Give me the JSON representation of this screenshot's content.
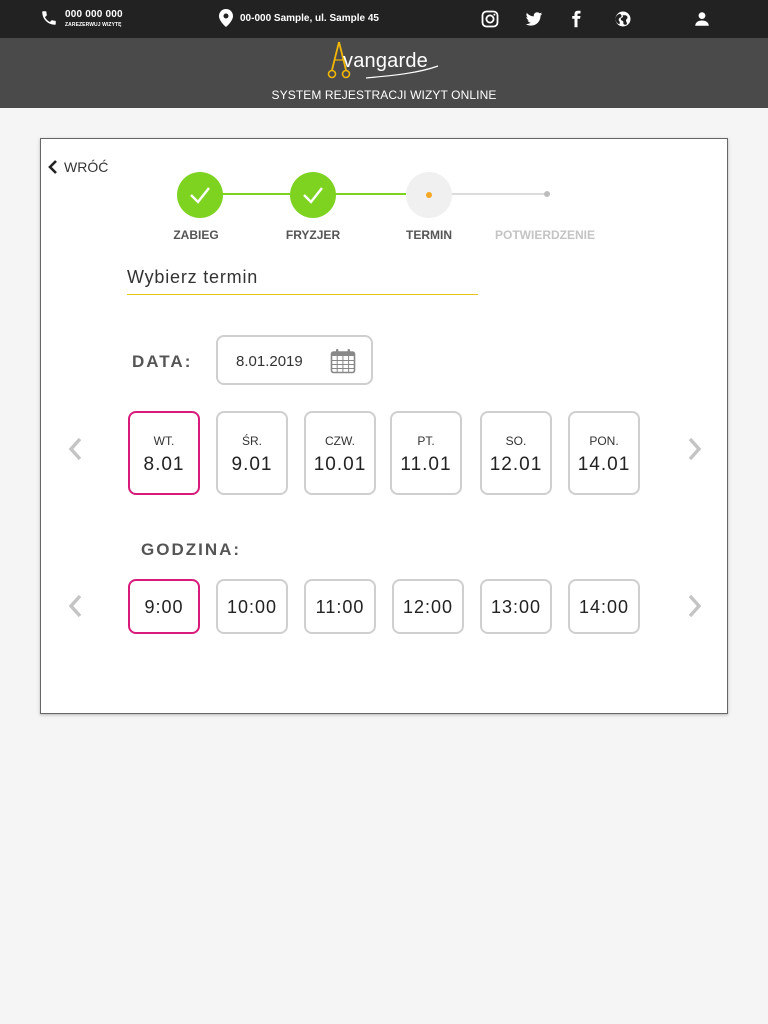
{
  "topbar": {
    "phone": "000 000 000",
    "phone_sub": "ZAREZERWUJ WIZYTĘ",
    "address": "00-000 Sample, ul. Sample 45",
    "icons": [
      "phone-icon",
      "map-pin-icon",
      "instagram-icon",
      "twitter-icon",
      "facebook-icon",
      "globe-icon",
      "user-icon"
    ]
  },
  "header": {
    "logo_text": "vangarde",
    "subtitle": "SYSTEM REJESTRACJI WIZYT ONLINE"
  },
  "back": {
    "label": "WRÓĆ"
  },
  "steps": [
    {
      "label": "ZABIEG",
      "state": "done"
    },
    {
      "label": "FRYZJER",
      "state": "done"
    },
    {
      "label": "TERMIN",
      "state": "current"
    },
    {
      "label": "POTWIERDZENIE",
      "state": "pending"
    }
  ],
  "section": {
    "title": "Wybierz termin"
  },
  "date": {
    "label": "DATA:",
    "value": "8.01.2019"
  },
  "days": [
    {
      "name": "WT.",
      "date": "8.01",
      "selected": true
    },
    {
      "name": "ŚR.",
      "date": "9.01",
      "selected": false
    },
    {
      "name": "CZW.",
      "date": "10.01",
      "selected": false
    },
    {
      "name": "PT.",
      "date": "11.01",
      "selected": false
    },
    {
      "name": "SO.",
      "date": "12.01",
      "selected": false
    },
    {
      "name": "PON.",
      "date": "14.01",
      "selected": false
    }
  ],
  "hours": {
    "label": "GODZINA:",
    "items": [
      {
        "value": "9:00",
        "selected": true
      },
      {
        "value": "10:00",
        "selected": false
      },
      {
        "value": "11:00",
        "selected": false
      },
      {
        "value": "12:00",
        "selected": false
      },
      {
        "value": "13:00",
        "selected": false
      },
      {
        "value": "14:00",
        "selected": false
      }
    ]
  },
  "colors": {
    "accent_selected": "#d81b7a",
    "step_done": "#7ed321",
    "step_current_dot": "#f5a623",
    "underline": "#e5c41a",
    "topbar": "#222222",
    "header": "#4a4a4a"
  }
}
